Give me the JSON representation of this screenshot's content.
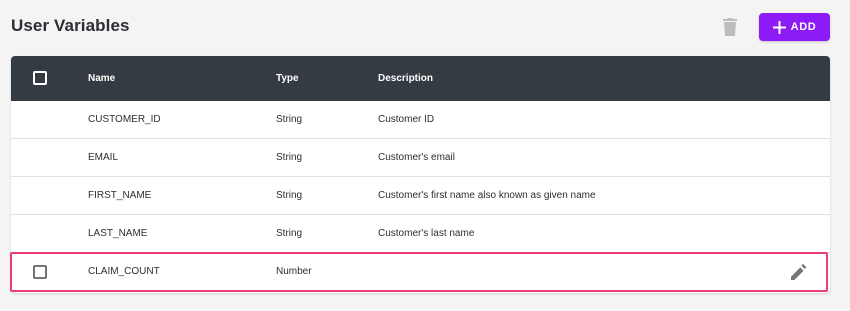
{
  "page": {
    "title": "User Variables"
  },
  "toolbar": {
    "delete_icon": "trash-icon",
    "add_label": "ADD",
    "add_icon": "plus-icon",
    "accent": "#8c1bf5"
  },
  "table": {
    "header_bg": "#353b42",
    "columns": {
      "name": "Name",
      "type": "Type",
      "description": "Description"
    },
    "rows": [
      {
        "name": "CUSTOMER_ID",
        "type": "String",
        "description": "Customer ID"
      },
      {
        "name": "EMAIL",
        "type": "String",
        "description": "Customer's email"
      },
      {
        "name": "FIRST_NAME",
        "type": "String",
        "description": "Customer's first name also known as given name"
      },
      {
        "name": "LAST_NAME",
        "type": "String",
        "description": "Customer's last name"
      },
      {
        "name": "CLAIM_COUNT",
        "type": "Number",
        "description": "",
        "hovered": true,
        "edit_icon": "pencil-icon"
      }
    ]
  },
  "highlight_color": "#ee3d72"
}
